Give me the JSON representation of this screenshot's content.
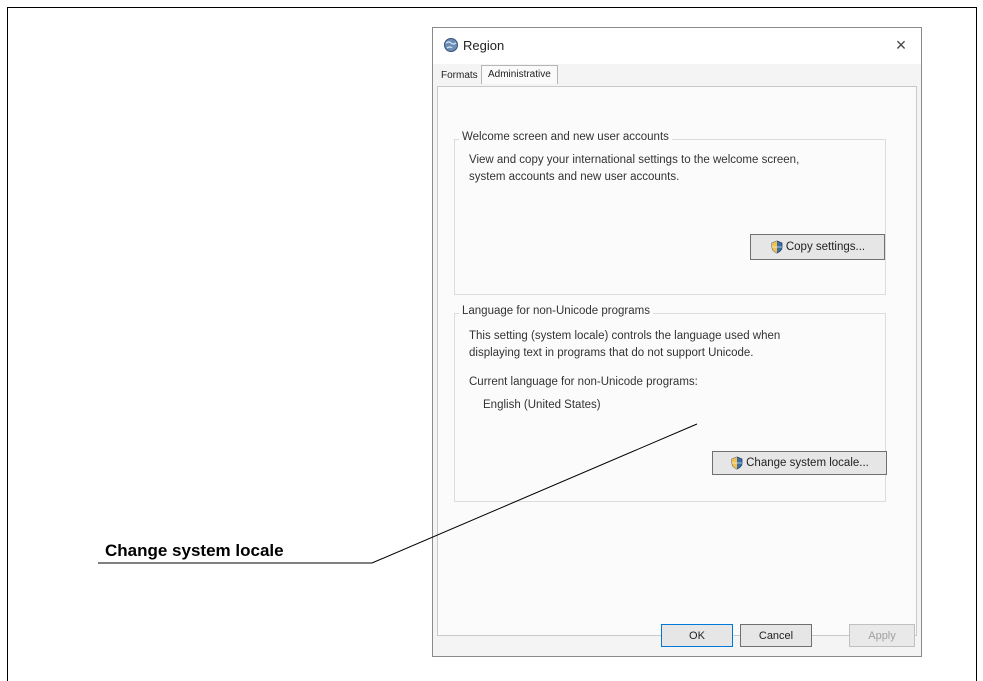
{
  "dialog": {
    "title": "Region",
    "close_glyph": "×",
    "tabs": [
      {
        "label": "Formats",
        "active": false
      },
      {
        "label": "Administrative",
        "active": true
      }
    ]
  },
  "welcome_group": {
    "title": "Welcome screen and new user accounts",
    "description_line1": "View and copy your international settings to the welcome screen,",
    "description_line2": "system accounts and new user accounts.",
    "button_label": "Copy settings..."
  },
  "locale_group": {
    "title": "Language for non-Unicode programs",
    "description_line1": "This setting (system locale) controls the language used when",
    "description_line2": "displaying text in programs that do not support Unicode.",
    "current_label": "Current language for non-Unicode programs:",
    "current_value": "English (United States)",
    "button_label": "Change system locale..."
  },
  "footer": {
    "ok_label": "OK",
    "cancel_label": "Cancel",
    "apply_label": "Apply"
  },
  "callout": {
    "label": "Change system locale"
  },
  "icons": {
    "app": "region-globe-icon",
    "shield": "uac-shield-icon",
    "close": "close-icon"
  },
  "colors": {
    "accent": "#0078d7",
    "uac_shield": "#3a6ea5"
  }
}
